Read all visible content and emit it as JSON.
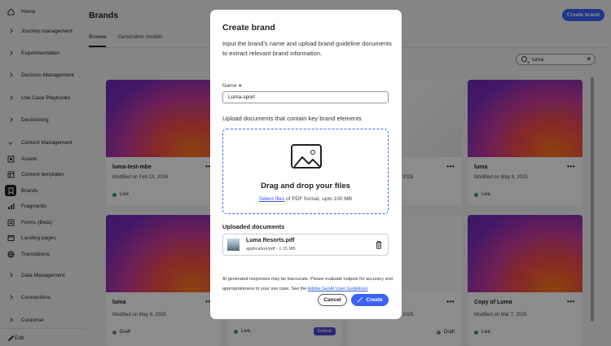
{
  "sidebar": {
    "items": [
      {
        "label": "Home",
        "icon": "home-icon"
      },
      {
        "label": "Journey management",
        "icon": "chevron-right-icon"
      },
      {
        "label": "Experimentation",
        "icon": "chevron-right-icon"
      },
      {
        "label": "Decision Management",
        "icon": "chevron-right-icon"
      },
      {
        "label": "Use Case Playbooks",
        "icon": "chevron-right-icon"
      },
      {
        "label": "Decisioning",
        "icon": "chevron-right-icon"
      },
      {
        "label": "Content Management",
        "icon": "chevron-down-icon"
      },
      {
        "label": "Assets",
        "icon": "assets-icon"
      },
      {
        "label": "Content templates",
        "icon": "template-icon"
      },
      {
        "label": "Brands",
        "icon": "brand-icon"
      },
      {
        "label": "Fragments",
        "icon": "fragments-icon"
      },
      {
        "label": "Forms (Beta)",
        "icon": "forms-icon"
      },
      {
        "label": "Landing pages",
        "icon": "landing-icon"
      },
      {
        "label": "Translations",
        "icon": "globe-icon"
      },
      {
        "label": "Data Management",
        "icon": "chevron-right-icon"
      },
      {
        "label": "Connections",
        "icon": "chevron-right-icon"
      },
      {
        "label": "Customer",
        "icon": "chevron-right-icon"
      }
    ],
    "edit_label": "Edit"
  },
  "header": {
    "title": "Brands",
    "create_button": "Create brand",
    "tabs": [
      "Browse",
      "Generative models"
    ]
  },
  "search": {
    "value": "luma"
  },
  "cards": [
    {
      "title": "luma-test-mbe",
      "modified": "Modified on Feb 13, 2026",
      "status": "Live",
      "badge": ""
    },
    {
      "title": "",
      "modified": "2025",
      "status": "",
      "badge": ""
    },
    {
      "title": "luma",
      "modified": "Modified on May 8, 2025",
      "status": "Live",
      "badge": ""
    },
    {
      "title": "luma",
      "modified": "Modified on May 8, 2025",
      "status": "Draft",
      "badge": ""
    },
    {
      "title": "",
      "modified": "",
      "status": "Live",
      "badge": "Default"
    },
    {
      "title": "",
      "modified": "2025",
      "status": "Draft",
      "badge": ""
    },
    {
      "title": "Copy of Luma",
      "modified": "Modified on Mar 7, 2025",
      "status": "Live",
      "badge": ""
    }
  ],
  "modal": {
    "title": "Create brand",
    "description": "Input the brand's name and upload brand guideline documents to extract relevant brand information.",
    "name_label": "Name",
    "name_value": "Luma-sport",
    "upload_label": "Upload documents that contain key brand elements",
    "dropzone_title": "Drag and drop your files",
    "dropzone_link": "Select files",
    "dropzone_rest": " of PDF format, upto 100 MB",
    "uploaded_label": "Uploaded documents",
    "file": {
      "name": "Luma Resorts.pdf",
      "meta": "application/pdf - 1.15 MB"
    },
    "disclaimer": "AI generated responses may be inaccurate. Please evaluate outputs for accuracy and appropriateness to your use case. See the ",
    "disclaimer_link": "Adobe GenAI User Guidelines",
    "disclaimer_end": ".",
    "cancel": "Cancel",
    "create": "Create"
  },
  "colors": {
    "accent": "#3b63fb",
    "live": "#2d9d78"
  }
}
